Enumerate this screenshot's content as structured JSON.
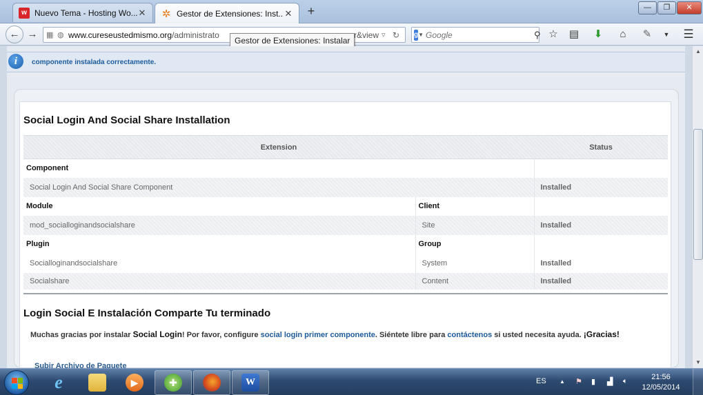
{
  "browser": {
    "tabs": [
      {
        "label": "Nuevo Tema - Hosting Wo...",
        "close": "✕"
      },
      {
        "label": "Gestor de Extensiones: Inst...",
        "close": "✕"
      }
    ],
    "new_tab": "+",
    "window_controls": {
      "minimize": "—",
      "maximize": "❐",
      "close": "✕"
    },
    "url_host": "www.cureseustedmismo.org",
    "url_path": "/administrato",
    "url_tail": "er&view",
    "tooltip": "Gestor de Extensiones: Instalar",
    "search_engine": "g",
    "search_placeholder": "Google"
  },
  "message": {
    "text": "componente instalada correctamente."
  },
  "install": {
    "title": "Social Login And Social Share Installation",
    "columns": {
      "extension": "Extension",
      "status": "Status"
    },
    "component": {
      "header": "Component",
      "rows": [
        {
          "name": "Social Login And Social Share Component",
          "status": "Installed"
        }
      ]
    },
    "module": {
      "header": "Module",
      "client_header": "Client",
      "rows": [
        {
          "name": "mod_socialloginandsocialshare",
          "client": "Site",
          "status": "Installed"
        }
      ]
    },
    "plugin": {
      "header": "Plugin",
      "group_header": "Group",
      "rows": [
        {
          "name": "Socialloginandsocialshare",
          "group": "System",
          "status": "Installed"
        },
        {
          "name": "Socialshare",
          "group": "Content",
          "status": "Installed"
        }
      ]
    },
    "done_title": "Login Social E Instalación Comparte Tu terminado",
    "thanks": {
      "p1": "Muchas gracias por instalar ",
      "brand": "Social Login",
      "p2": "! Por favor, configure ",
      "link1": "social login primer componente",
      "p3": ". Siéntete libre para ",
      "link2": "contáctenos",
      "p4": " si usted necesita ayuda. ",
      "closing": "¡Gracias!"
    },
    "upload_link": "Subir Archivo de Paquete"
  },
  "taskbar": {
    "language": "ES",
    "clock_time": "21:56",
    "clock_date": "12/05/2014",
    "word_letter": "W",
    "ie_letter": "e"
  },
  "colors": {
    "installed": "#5d9e1f",
    "link": "#1d5a9a",
    "info": "#1e5b9c"
  }
}
